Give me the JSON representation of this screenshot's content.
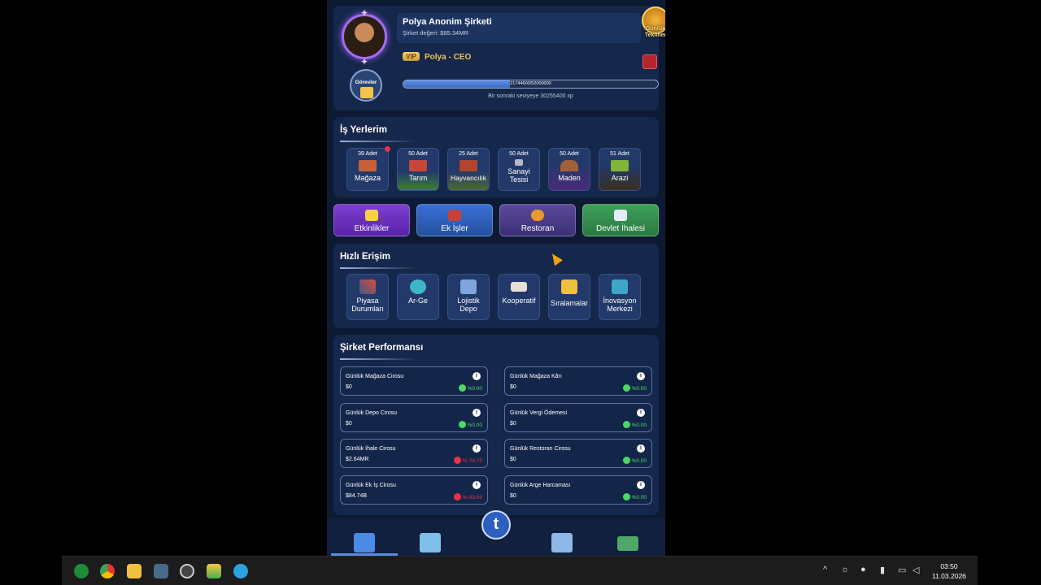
{
  "company": {
    "name": "Polya Anonim Şirketi",
    "worth": "Şirket değeri: $85.34MR",
    "vip": "VIP",
    "role": "Polya - CEO",
    "daily_offers": "Günlük Teklifler",
    "tasks": "Görevler",
    "xp_text": "21744600/52000000",
    "xp_progress": 0.418,
    "next_level": "Bir sonraki seviyeye 30255400 xp"
  },
  "workplaces": {
    "title": "İş Yerlerim",
    "items": [
      {
        "count": "39 Adet",
        "label": "Mağaza",
        "icon": "store-icon",
        "color": "#c8613a"
      },
      {
        "count": "50 Adet",
        "label": "Tarım",
        "icon": "farm-icon",
        "color": "#c8463a"
      },
      {
        "count": "25 Adet",
        "label": "Hayvancılık",
        "icon": "livestock-icon",
        "color": "#b3452f"
      },
      {
        "count": "50 Adet",
        "label": "Sanayi Tesisi",
        "icon": "factory-icon",
        "color": "#b8b8c8"
      },
      {
        "count": "50 Adet",
        "label": "Maden",
        "icon": "mine-icon",
        "color": "#a0603a"
      },
      {
        "count": "51 Adet",
        "label": "Arazi",
        "icon": "land-icon",
        "color": "#7fb53a"
      }
    ]
  },
  "actions": [
    {
      "label": "Etkinlikler",
      "icon": "events-icon"
    },
    {
      "label": "Ek İşler",
      "icon": "extra-jobs-icon"
    },
    {
      "label": "Restoran",
      "icon": "restaurant-icon"
    },
    {
      "label": "Devlet İhalesi",
      "icon": "tender-icon"
    }
  ],
  "quick": {
    "title": "Hızlı Erişim",
    "items": [
      {
        "label": "Piyasa Durumları",
        "icon": "market-chart-icon"
      },
      {
        "label": "Ar-Ge",
        "icon": "research-icon"
      },
      {
        "label": "Lojistik Depo",
        "icon": "warehouse-icon"
      },
      {
        "label": "Kooperatif",
        "icon": "handshake-icon"
      },
      {
        "label": "Sıralamalar",
        "icon": "podium-icon"
      },
      {
        "label": "İnovasyon Merkezi",
        "icon": "innovation-icon"
      }
    ]
  },
  "performance": {
    "title": "Şirket Performansı",
    "info": "i",
    "items": [
      {
        "title": "Günlük Mağaza Cirosu",
        "value": "$0",
        "change": "%0.00",
        "dir": "up"
      },
      {
        "title": "Günlük Mağaza Kârı",
        "value": "$0",
        "change": "%0.00",
        "dir": "up"
      },
      {
        "title": "Günlük Depo Cirosu",
        "value": "$0",
        "change": "%0.00",
        "dir": "up"
      },
      {
        "title": "Günlük Vergi Ödemesi",
        "value": "$0",
        "change": "%0.00",
        "dir": "up"
      },
      {
        "title": "Günlük İhale Cirosu",
        "value": "$2.64MR",
        "change": "%-78.75",
        "dir": "down"
      },
      {
        "title": "Günlük Restoran Cirosu",
        "value": "$0",
        "change": "%0.00",
        "dir": "up"
      },
      {
        "title": "Günlük Ek İş Cirosu",
        "value": "$84.74B",
        "change": "%-93.06",
        "dir": "down"
      },
      {
        "title": "Günlük Arge Harcaması",
        "value": "$0",
        "change": "%0.00",
        "dir": "up"
      }
    ]
  },
  "nav": {
    "center_label": "t",
    "items": [
      "dashboard-icon",
      "buildings-icon",
      "",
      "city-icon",
      "wallet-icon"
    ]
  },
  "taskbar": {
    "apps": [
      "xbox-icon",
      "chrome-icon",
      "file-explorer-icon",
      "calculator-icon",
      "game-app-icon",
      "bluestacks-icon",
      "telegram-icon"
    ],
    "time": "03:50",
    "date": "11.03.2026"
  },
  "colors": {
    "accent": "#3a6bc6",
    "positive": "#4cd964",
    "negative": "#e8324a",
    "gold": "#f0c458"
  }
}
